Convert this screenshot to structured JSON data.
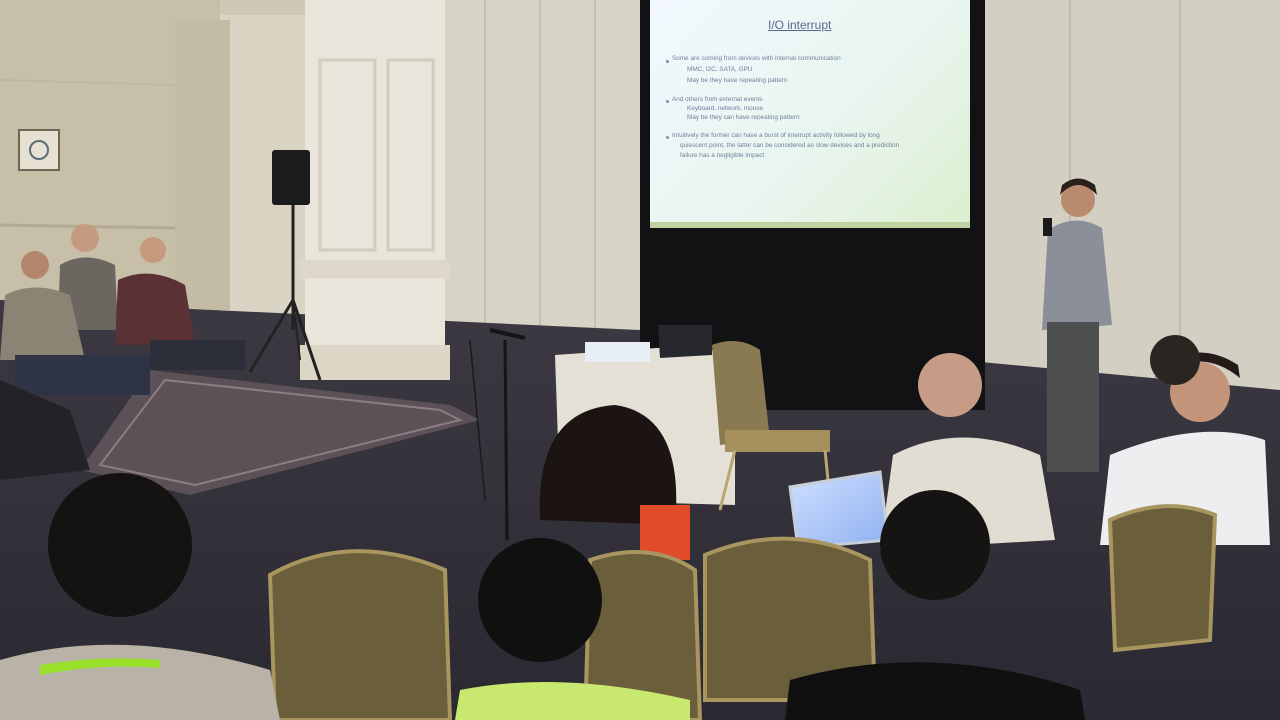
{
  "slide": {
    "title": "I/O interrupt",
    "bullets": [
      {
        "main": "Some are coming from devices with internal communication",
        "subs": [
          "MMC, I2C, SATA, GPU",
          "May be they have repeating pattern"
        ]
      },
      {
        "main": "And others from external events",
        "subs": [
          "Keyboard, network, mouse",
          "May be they can have repeating pattern"
        ]
      },
      {
        "main": "Intuitively the former can have a burst of interrupt activity followed by long",
        "subs": [
          "quiescent point, the latter can be considered as slow devices and a prediction",
          "failure has a negligible impact"
        ]
      }
    ]
  }
}
